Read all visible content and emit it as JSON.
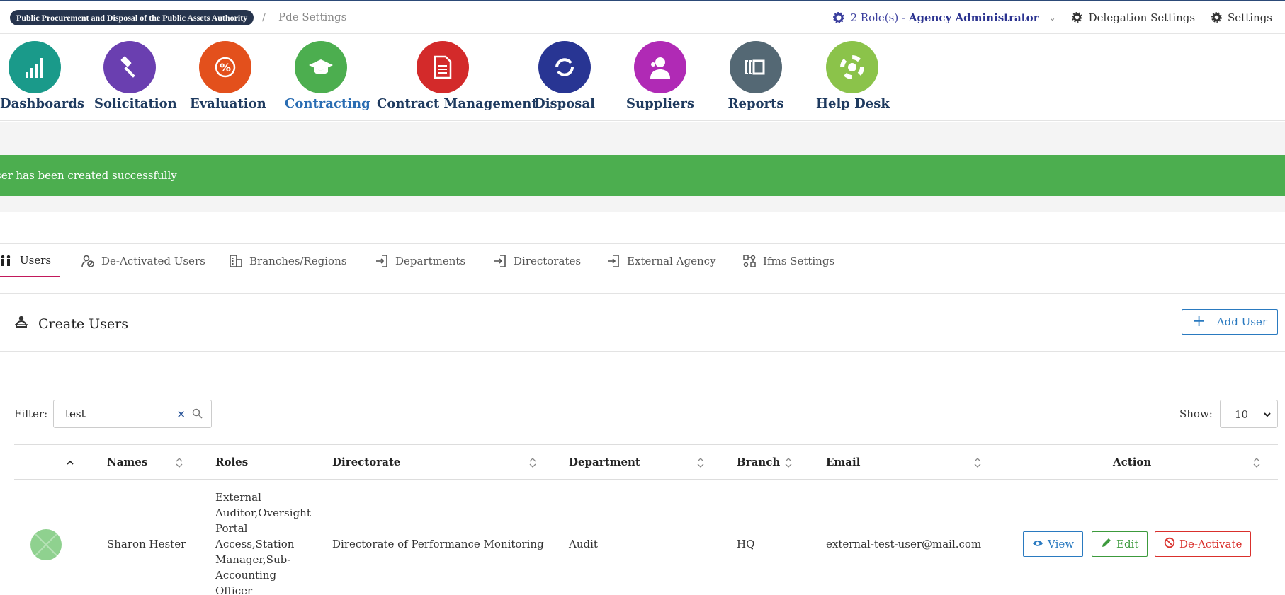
{
  "topbar": {
    "org_name": "Public Procurement and Disposal of the Public Assets Authority",
    "separator": "/",
    "current_page": "Pde Settings",
    "roles_count": "2 Role(s) - ",
    "role_name": "Agency Administrator",
    "delegation_label": "Delegation Settings",
    "settings_label": "Settings"
  },
  "modules": [
    {
      "label": "Dashboards",
      "color": "#1a9a8a",
      "icon": "bar-chart-icon"
    },
    {
      "label": "Solicitation",
      "color": "#6a3fb0",
      "icon": "gavel-icon"
    },
    {
      "label": "Evaluation",
      "color": "#e3501c",
      "icon": "percent-icon"
    },
    {
      "label": "Contracting",
      "color": "#4cae4f",
      "icon": "graduation-cap-icon",
      "active": true
    },
    {
      "label": "Contract Management",
      "color": "#d32a2a",
      "icon": "document-icon"
    },
    {
      "label": "Disposal",
      "color": "#283593",
      "icon": "recycle-icon"
    },
    {
      "label": "Suppliers",
      "color": "#b02ab5",
      "icon": "supplier-icon"
    },
    {
      "label": "Reports",
      "color": "#546874",
      "icon": "report-icon"
    },
    {
      "label": "Help Desk",
      "color": "#8bc34a",
      "icon": "lifebuoy-icon"
    }
  ],
  "alert": {
    "message": "ser has been created successfully",
    "color": "#4cae4f"
  },
  "tabs": [
    {
      "label": "Users",
      "icon": "users-icon",
      "active": true
    },
    {
      "label": "De-Activated Users",
      "icon": "user-blocked-icon"
    },
    {
      "label": "Branches/Regions",
      "icon": "building-icon"
    },
    {
      "label": "Departments",
      "icon": "door-enter-icon"
    },
    {
      "label": "Directorates",
      "icon": "door-enter-icon"
    },
    {
      "label": "External Agency",
      "icon": "door-enter-icon"
    },
    {
      "label": "Ifms Settings",
      "icon": "network-icon"
    }
  ],
  "panel": {
    "title": "Create Users",
    "add_button": "Add User"
  },
  "filter": {
    "label": "Filter:",
    "value": "test",
    "clear": "×"
  },
  "show": {
    "label": "Show:",
    "value": "10"
  },
  "table": {
    "columns": [
      "Names",
      "Roles",
      "Directorate",
      "Department",
      "Branch",
      "Email",
      "Action"
    ],
    "rows": [
      {
        "name": "Sharon Hester",
        "roles": [
          "External",
          "Auditor,Oversight",
          "Portal",
          "Access,Station",
          "Manager,Sub-",
          "Accounting",
          "Officer"
        ],
        "directorate": "Directorate of Performance Monitoring",
        "department": "Audit",
        "branch": "HQ",
        "email": "external-test-user@mail.com"
      }
    ],
    "actions": {
      "view": "View",
      "edit": "Edit",
      "deactivate": "De-Activate"
    }
  }
}
